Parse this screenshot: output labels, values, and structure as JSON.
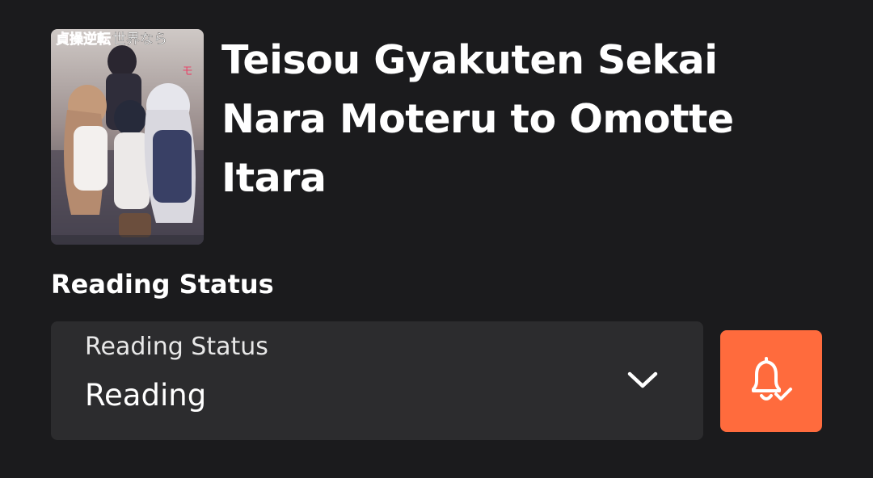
{
  "manga": {
    "title": "Teisou Gyakuten Sekai Nara Moteru to Omotte Itara",
    "cover_text": "貞操逆転世界なら"
  },
  "reading_status": {
    "heading": "Reading Status",
    "field_label": "Reading Status",
    "selected_value": "Reading",
    "dropdown_icon": "chevron-down-icon"
  },
  "notify_button": {
    "icon": "bell-check-icon",
    "background_color": "#ff6b3d"
  },
  "colors": {
    "background": "#1b1b1d",
    "select_background": "#2c2c2e",
    "accent": "#ff6b3d"
  }
}
